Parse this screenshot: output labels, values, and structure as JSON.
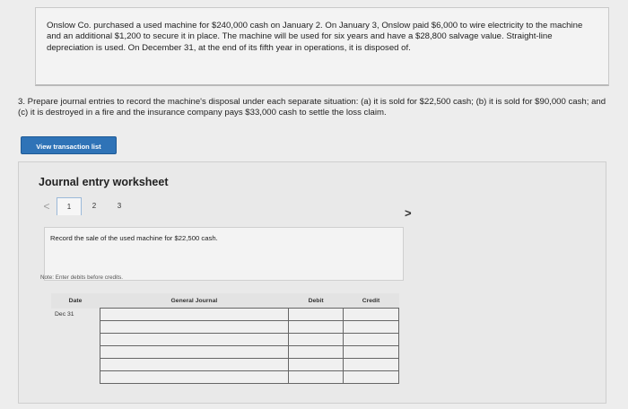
{
  "problem": {
    "text": "Onslow Co. purchased a used machine for $240,000 cash on January 2. On January 3, Onslow paid $6,000 to wire electricity to the machine and an additional $1,200 to secure it in place. The machine will be used for six years and have a $28,800 salvage value. Straight-line depreciation is used. On December 31, at the end of its fifth year in operations, it is disposed of."
  },
  "part3": {
    "text": "3. Prepare journal entries to record the machine's disposal under each separate situation: (a) it is sold for $22,500 cash; (b) it is sold for $90,000 cash; and (c) it is destroyed in a fire and the insurance company pays $33,000 cash to settle the loss claim."
  },
  "view_button": "View transaction list",
  "worksheet": {
    "title": "Journal entry worksheet",
    "prev": "<",
    "next": ">",
    "pages": [
      "1",
      "2",
      "3"
    ],
    "instruction": "Record the sale of the used machine for $22,500 cash.",
    "note": "Note: Enter debits before credits."
  },
  "journal": {
    "headers": {
      "date": "Date",
      "account": "General Journal",
      "debit": "Debit",
      "credit": "Credit"
    },
    "date_value": "Dec 31"
  }
}
